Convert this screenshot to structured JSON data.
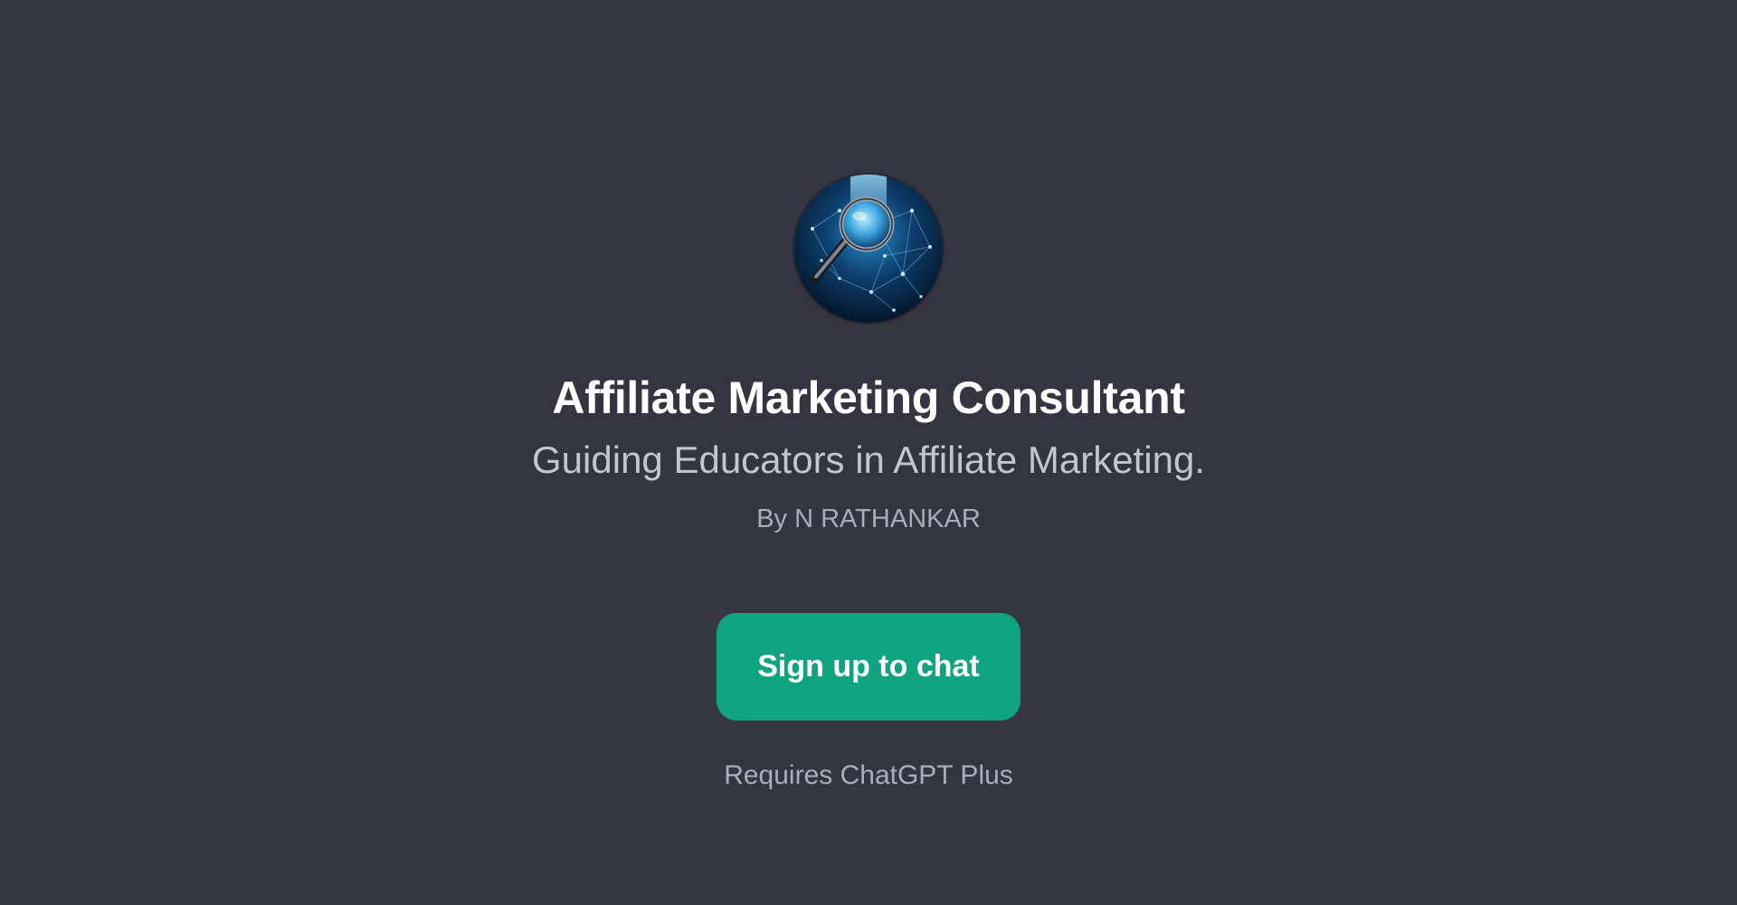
{
  "gpt": {
    "avatar_icon": "magnifying-glass-network-icon",
    "name": "Affiliate Marketing Consultant",
    "description": "Guiding Educators in Affiliate Marketing.",
    "author": "By N RATHANKAR"
  },
  "actions": {
    "signup_label": "Sign up to chat",
    "requirement": "Requires ChatGPT Plus"
  },
  "colors": {
    "background": "#343541",
    "accent": "#10a37f",
    "title": "#ffffff",
    "subtitle": "#c5c5d2",
    "muted": "#acacbe"
  }
}
